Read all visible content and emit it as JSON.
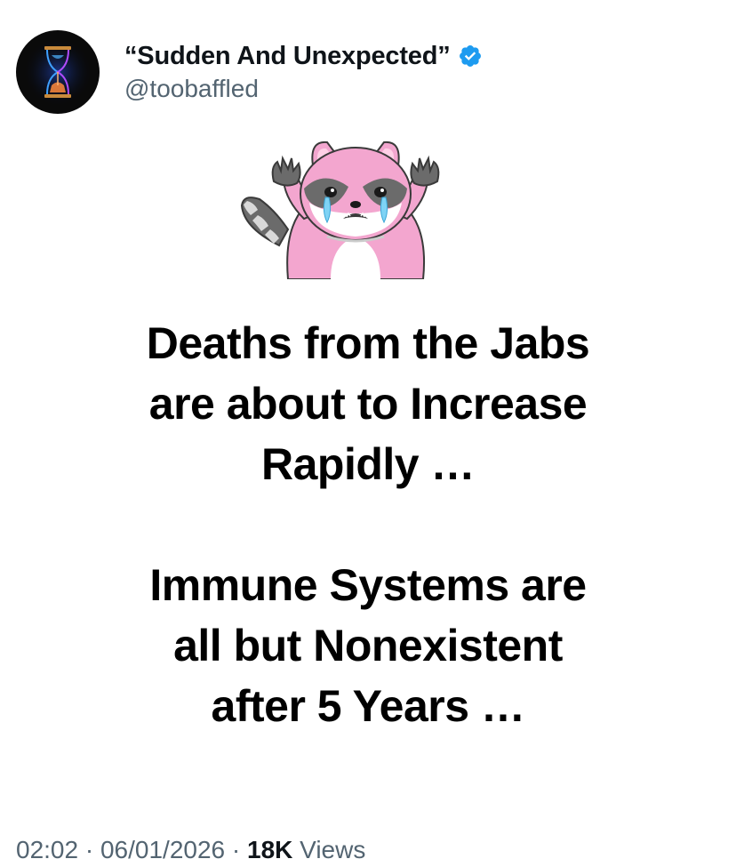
{
  "author": {
    "display_name": "“Sudden And Unexpected”",
    "handle": "@toobaffled",
    "verified": true,
    "avatar_icon": "hourglass-icon",
    "verified_icon": "verified-badge-icon"
  },
  "post": {
    "sticker_icon": "crying-raccoon-sticker",
    "lines": [
      "Deaths from the Jabs",
      "are about to Increase",
      "Rapidly …",
      "Immune Systems are",
      "all but Nonexistent",
      "after 5 Years …"
    ]
  },
  "meta": {
    "time": "02:02",
    "separator": "·",
    "date": "06/01/2026",
    "views_count": "18K",
    "views_label": "Views"
  },
  "colors": {
    "primary_text": "#0f1419",
    "secondary_text": "#536471",
    "verified_blue": "#1d9bf0",
    "sticker_pink": "#f3a6cf"
  }
}
